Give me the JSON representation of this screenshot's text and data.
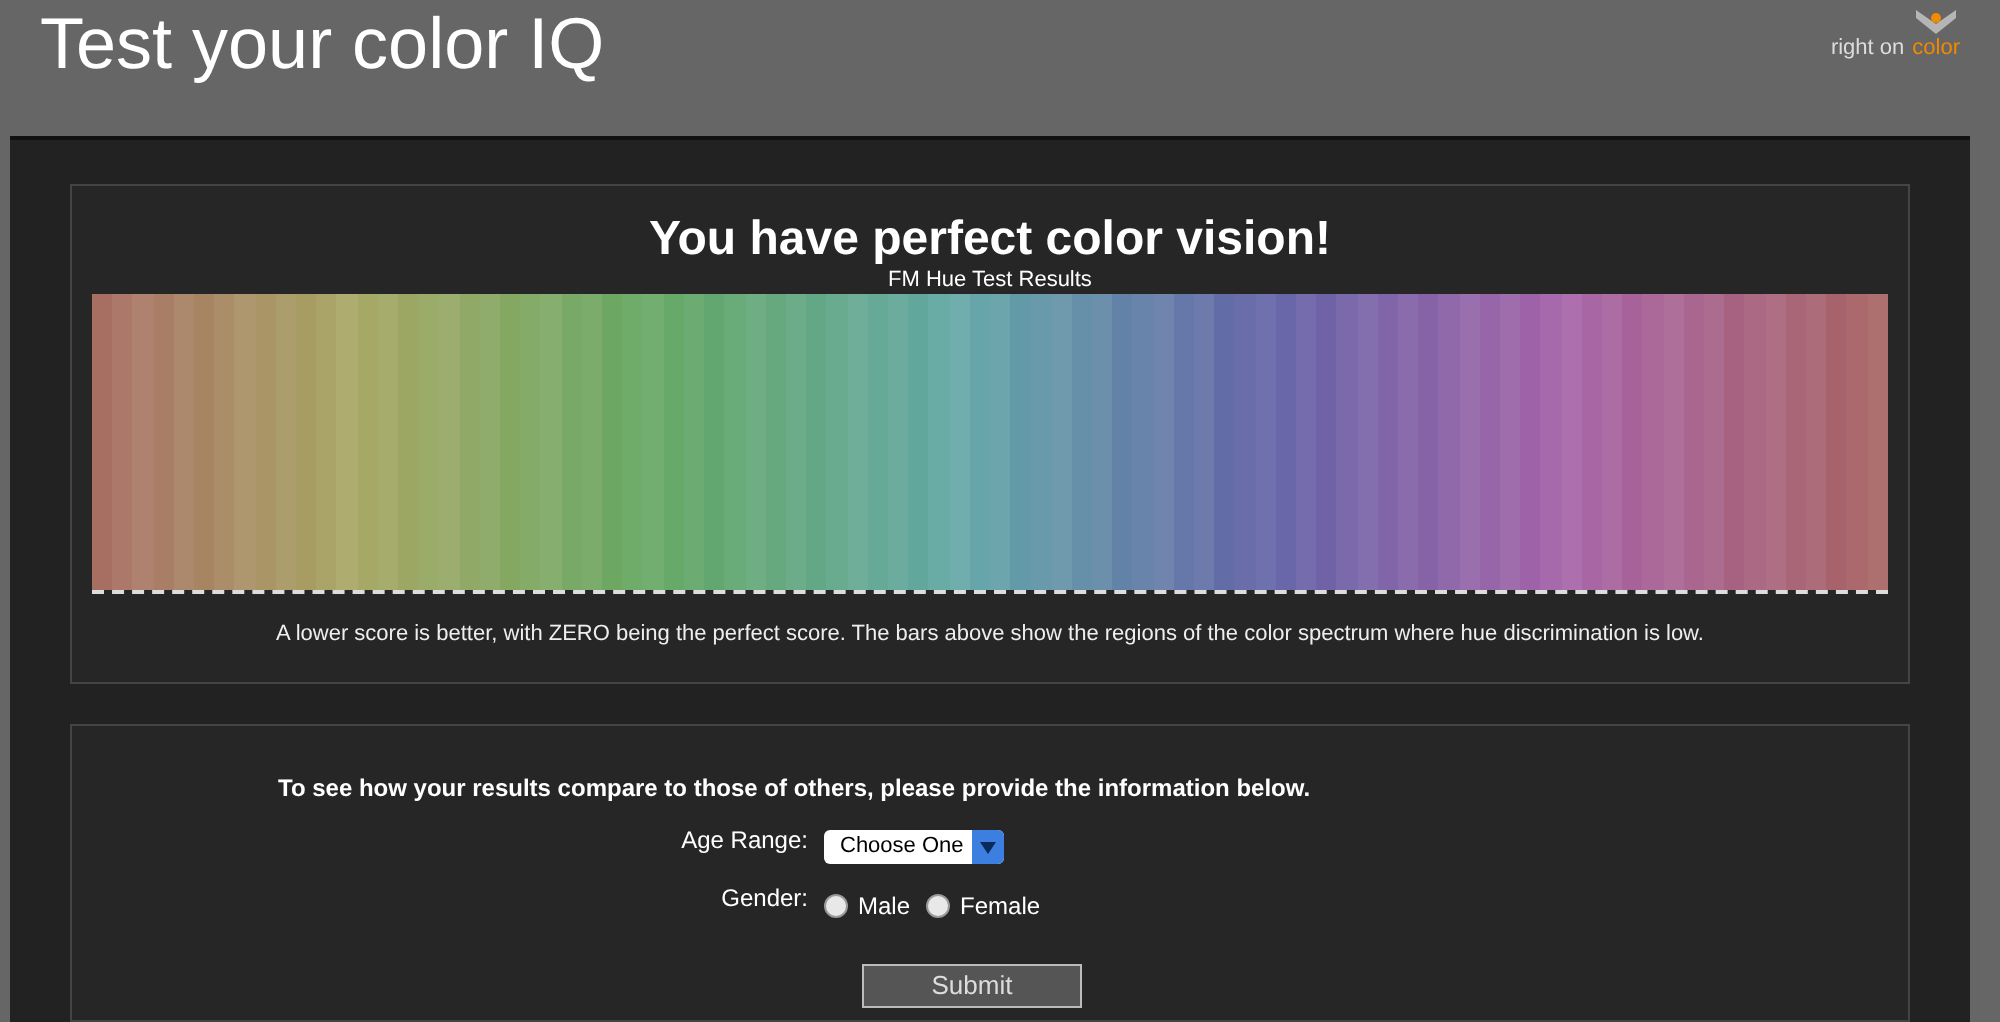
{
  "header": {
    "title": "Test your color IQ",
    "logo_tagline": "right on",
    "logo_tagline_accent": "color"
  },
  "results": {
    "heading": "You have perfect color vision!",
    "chart_title": "FM Hue Test Results",
    "note": "A lower score is better, with ZERO being the perfect score. The bars above show the regions of the color spectrum where hue discrimination is low."
  },
  "form": {
    "intro": "To see how your results compare to those of others, please provide the information below.",
    "age_label": "Age Range:",
    "age_select": {
      "value": "Choose One"
    },
    "gender_label": "Gender:",
    "gender_options": [
      {
        "label": "Male",
        "selected": false
      },
      {
        "label": "Female",
        "selected": false
      }
    ],
    "submit": "Submit"
  }
}
